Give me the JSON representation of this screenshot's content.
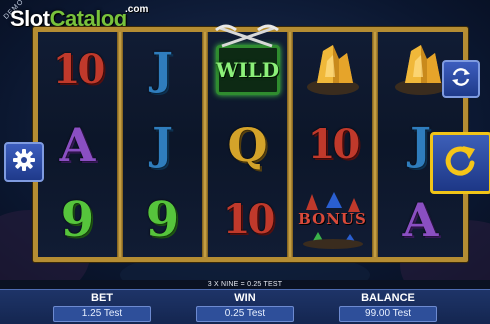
{
  "brand": {
    "logo_part1": "Slot",
    "logo_part2": "Catalog",
    "logo_suffix": ".com",
    "demo_ribbon": "DEMO"
  },
  "reels": [
    [
      "10",
      "A",
      "9"
    ],
    [
      "J",
      "J",
      "9"
    ],
    [
      "WILD",
      "Q",
      "10"
    ],
    [
      "crystal",
      "10",
      "BONUS"
    ],
    [
      "crystal",
      "J",
      "A"
    ]
  ],
  "status": {
    "message": "3 X NINE = 0.25 TEST"
  },
  "meters": {
    "bet": {
      "label": "BET",
      "value": "1.25 Test"
    },
    "win": {
      "label": "WIN",
      "value": "0.25 Test"
    },
    "balance": {
      "label": "BALANCE",
      "value": "99.00 Test"
    }
  },
  "buttons": {
    "spin": "refresh-arrow-icon",
    "autospin": "autoplay-cycle-icon",
    "settings": "gear-icon"
  },
  "colors": {
    "frame": "#b58d33",
    "spin_border": "#f0c418",
    "panel": "#1e3468"
  }
}
